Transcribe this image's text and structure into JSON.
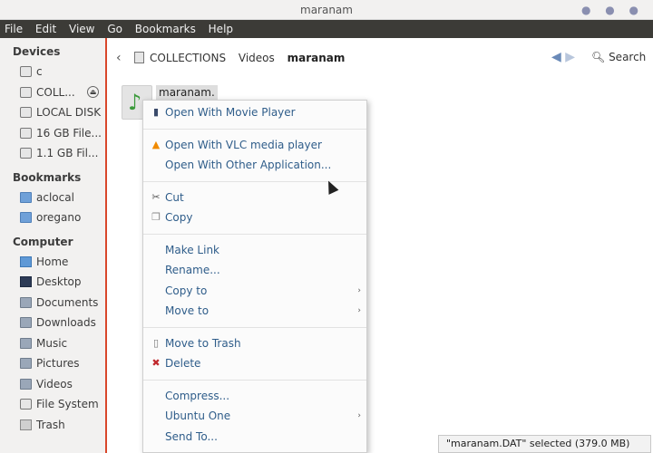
{
  "window": {
    "title": "maranam"
  },
  "menubar": [
    "File",
    "Edit",
    "View",
    "Go",
    "Bookmarks",
    "Help"
  ],
  "sidebar": {
    "devices_header": "Devices",
    "devices": [
      {
        "label": "c",
        "icon": "drive-icon"
      },
      {
        "label": "COLL...",
        "icon": "drive-icon",
        "eject": true
      },
      {
        "label": "LOCAL DISK",
        "icon": "drive-icon"
      },
      {
        "label": "16 GB File...",
        "icon": "drive-icon"
      },
      {
        "label": "1.1 GB Fil...",
        "icon": "drive-icon"
      }
    ],
    "bookmarks_header": "Bookmarks",
    "bookmarks": [
      {
        "label": "aclocal",
        "icon": "folder-icon"
      },
      {
        "label": "oregano",
        "icon": "folder-icon"
      }
    ],
    "computer_header": "Computer",
    "computer": [
      {
        "label": "Home",
        "icon": "home-folder-icon"
      },
      {
        "label": "Desktop",
        "icon": "desktop-icon"
      },
      {
        "label": "Documents",
        "icon": "folder-icon"
      },
      {
        "label": "Downloads",
        "icon": "folder-icon"
      },
      {
        "label": "Music",
        "icon": "folder-icon"
      },
      {
        "label": "Pictures",
        "icon": "folder-icon"
      },
      {
        "label": "Videos",
        "icon": "folder-icon"
      },
      {
        "label": "File System",
        "icon": "drive-icon"
      },
      {
        "label": "Trash",
        "icon": "trash-icon"
      }
    ]
  },
  "toolbar": {
    "back_icon": "chevron-left-icon",
    "breadcrumbs": [
      "COLLECTIONS",
      "Videos",
      "maranam"
    ],
    "search_label": "Search"
  },
  "content": {
    "file_label": "maranam."
  },
  "context_menu": {
    "items": [
      {
        "label": "Open With Movie Player",
        "icon": "movie-player-icon"
      },
      {
        "separator": true
      },
      {
        "label": "Open With VLC media player",
        "icon": "vlc-icon"
      },
      {
        "label": "Open With Other Application...",
        "icon": ""
      },
      {
        "separator": true
      },
      {
        "label": "Cut",
        "icon": "scissors-icon"
      },
      {
        "label": "Copy",
        "icon": "copy-icon"
      },
      {
        "separator": true
      },
      {
        "label": "Make Link",
        "icon": ""
      },
      {
        "label": "Rename...",
        "icon": ""
      },
      {
        "label": "Copy to",
        "icon": "",
        "submenu": true
      },
      {
        "label": "Move to",
        "icon": "",
        "submenu": true
      },
      {
        "separator": true
      },
      {
        "label": "Move to Trash",
        "icon": "trash-icon"
      },
      {
        "label": "Delete",
        "icon": "delete-x-icon"
      },
      {
        "separator": true
      },
      {
        "label": "Compress...",
        "icon": ""
      },
      {
        "label": "Ubuntu One",
        "icon": "",
        "submenu": true
      },
      {
        "label": "Send To...",
        "icon": ""
      }
    ]
  },
  "statusbar": {
    "text": "\"maranam.DAT\" selected (379.0 MB)"
  }
}
